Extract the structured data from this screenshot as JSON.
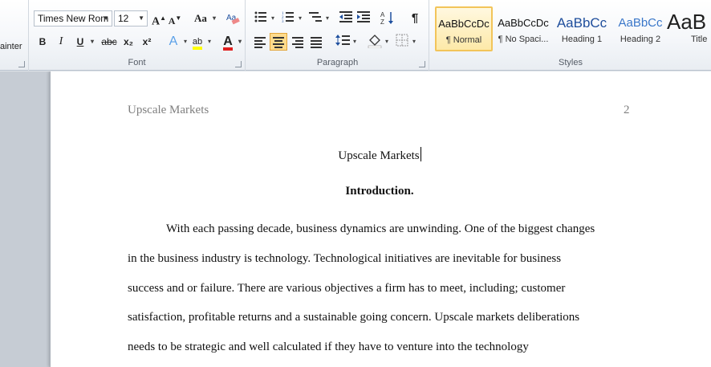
{
  "ribbon": {
    "clipboard": {
      "painter_fragment": "ainter"
    },
    "font": {
      "label": "Font",
      "font_name": "Times New Rom",
      "font_size": "12",
      "grow_font": "A",
      "shrink_font": "A",
      "change_case": "Aa",
      "bold": "B",
      "italic": "I",
      "underline": "U",
      "strikethrough": "abc",
      "subscript": "x₂",
      "superscript": "x²",
      "text_effects": "A",
      "font_color": "A",
      "highlight": "ab"
    },
    "paragraph": {
      "label": "Paragraph",
      "show_marks": "¶"
    },
    "styles": {
      "label": "Styles",
      "items": [
        {
          "sample": "AaBbCcDc",
          "name": "¶ Normal"
        },
        {
          "sample": "AaBbCcDc",
          "name": "¶ No Spaci..."
        },
        {
          "sample": "AaBbCc",
          "name": "Heading 1"
        },
        {
          "sample": "AaBbCc",
          "name": "Heading 2"
        },
        {
          "sample": "AaB",
          "name": "Title"
        }
      ],
      "colors": {
        "heading1": "#1f4e9c",
        "heading2": "#3a77c9",
        "title": "#1f1f1f"
      }
    }
  },
  "document": {
    "header_left": "Upscale Markets",
    "page_number": "2",
    "title": "Upscale Markets",
    "section_heading": "Introduction.",
    "lines": [
      "With each passing decade, business dynamics are unwinding. One of the biggest changes",
      "in the business industry is technology. Technological initiatives are inevitable for business",
      "success and or failure. There are various objectives a firm has to meet, including; customer",
      "satisfaction, profitable returns and a sustainable going concern. Upscale markets deliberations",
      "needs to be strategic and well calculated if they have to venture into the technology"
    ]
  }
}
